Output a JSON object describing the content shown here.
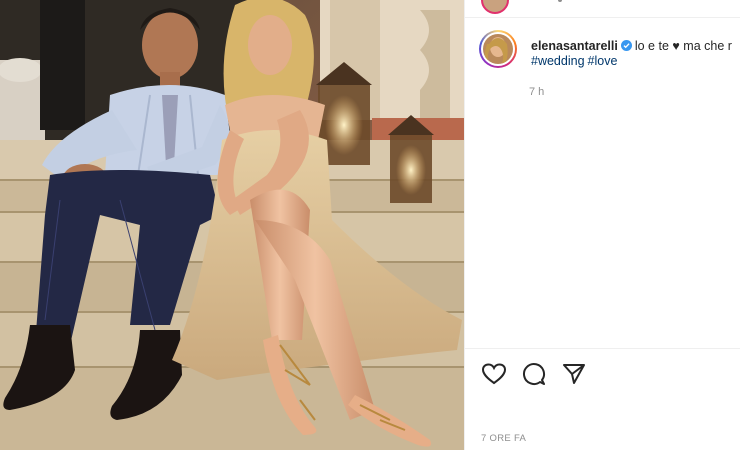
{
  "post": {
    "username": "elenasantarelli",
    "caption": "lo e te ♥ ma che r",
    "hashtags": [
      "#wedding",
      "#love"
    ],
    "time_ago": "7 h",
    "date_label": "7 ORE FA"
  },
  "icons": {
    "verified": "verified-badge-icon",
    "like": "heart-icon",
    "comment": "comment-icon",
    "share": "share-icon"
  },
  "colors": {
    "link": "#00376b",
    "verified": "#3897f0",
    "muted": "#8e8e8e",
    "text": "#262626"
  }
}
